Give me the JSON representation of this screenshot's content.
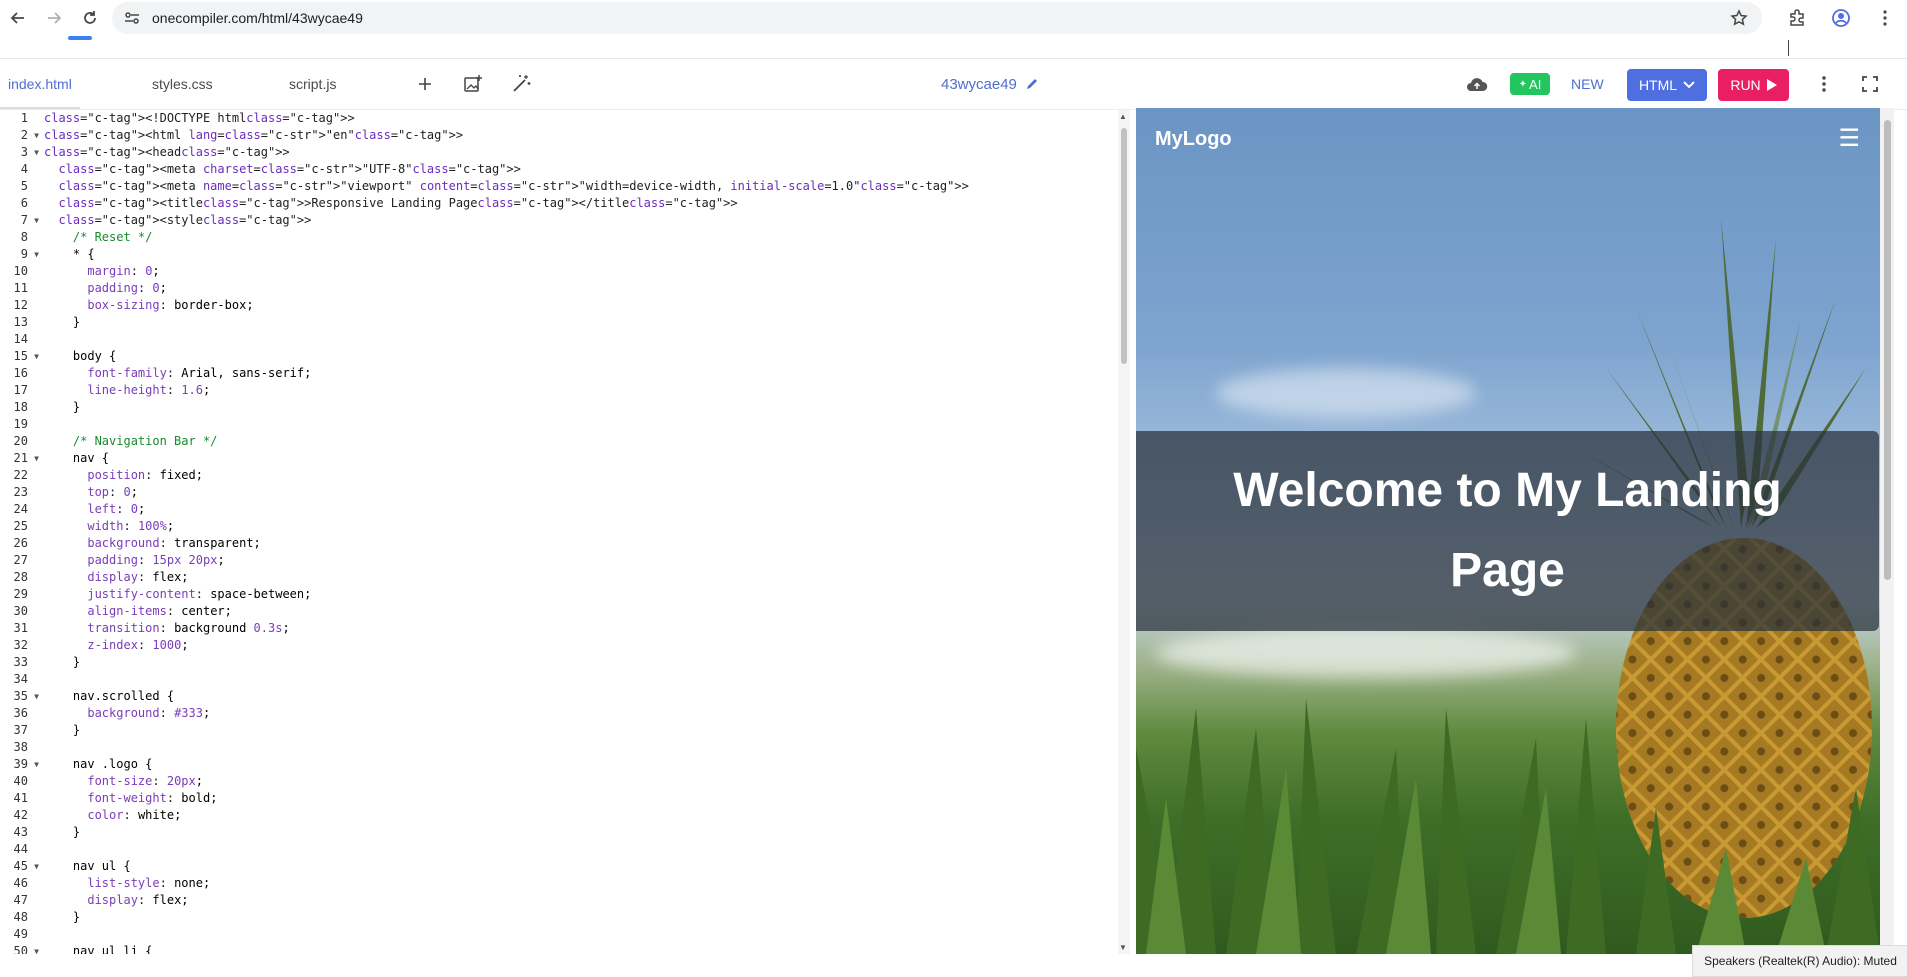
{
  "browser": {
    "url": "onecompiler.com/html/43wycae49"
  },
  "toolbar": {
    "tabs": [
      {
        "label": "index.html",
        "active": true
      },
      {
        "label": "styles.css",
        "active": false
      },
      {
        "label": "script.js",
        "active": false
      }
    ],
    "project_name": "43wycae49",
    "ai_label": "AI",
    "new_label": "NEW",
    "language_label": "HTML",
    "run_label": "RUN",
    "colors": {
      "accent": "#4f6fcf",
      "ai": "#22c55e",
      "language": "#4f6ee0",
      "run": "#e91e63"
    }
  },
  "editor": {
    "line_numbers": [
      "1",
      "2",
      "3",
      "4",
      "5",
      "6",
      "7",
      "8",
      "9",
      "10",
      "11",
      "12",
      "13",
      "14",
      "15",
      "16",
      "17",
      "18",
      "19",
      "20",
      "21",
      "22",
      "23",
      "24",
      "25",
      "26",
      "27",
      "28",
      "29",
      "30",
      "31",
      "32",
      "33",
      "34",
      "35",
      "36",
      "37",
      "38",
      "39",
      "40",
      "41",
      "42",
      "43",
      "44",
      "45",
      "46",
      "47",
      "48",
      "49",
      "50"
    ],
    "lines": [
      "<!DOCTYPE html>",
      "<html lang=\"en\">",
      "<head>",
      "  <meta charset=\"UTF-8\">",
      "  <meta name=\"viewport\" content=\"width=device-width, initial-scale=1.0\">",
      "  <title>Responsive Landing Page</title>",
      "  <style>",
      "    /* Reset */",
      "    * {",
      "      margin: 0;",
      "      padding: 0;",
      "      box-sizing: border-box;",
      "    }",
      "",
      "    body {",
      "      font-family: Arial, sans-serif;",
      "      line-height: 1.6;",
      "    }",
      "",
      "    /* Navigation Bar */",
      "    nav {",
      "      position: fixed;",
      "      top: 0;",
      "      left: 0;",
      "      width: 100%;",
      "      background: transparent;",
      "      padding: 15px 20px;",
      "      display: flex;",
      "      justify-content: space-between;",
      "      align-items: center;",
      "      transition: background 0.3s;",
      "      z-index: 1000;",
      "    }",
      "",
      "    nav.scrolled {",
      "      background: #333;",
      "    }",
      "",
      "    nav .logo {",
      "      font-size: 20px;",
      "      font-weight: bold;",
      "      color: white;",
      "    }",
      "",
      "    nav ul {",
      "      list-style: none;",
      "      display: flex;",
      "    }",
      "",
      "    nav ul li {"
    ]
  },
  "preview": {
    "logo": "MyLogo",
    "menu_icon": "hamburger-icon",
    "hero_title": "Welcome to My Landing Page"
  },
  "toast": "Speakers (Realtek(R) Audio): Muted"
}
